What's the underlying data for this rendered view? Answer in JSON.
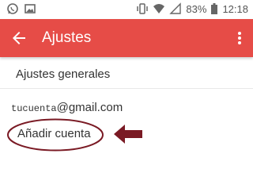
{
  "status_bar": {
    "battery_percent": "83%",
    "time": "12:18",
    "left_icons": [
      "whatsapp-icon",
      "image-icon"
    ],
    "right_icons": [
      "vibrate-icon",
      "wifi-icon",
      "signal-icon",
      "battery-icon"
    ]
  },
  "app_bar": {
    "title": "Ajustes",
    "background": "#e64c47",
    "back_icon": "arrow-back-icon",
    "menu_icon": "more-vert-icon"
  },
  "settings": {
    "general_label": "Ajustes generales",
    "account": {
      "user": "tucuenta",
      "domain": "@gmail.com"
    },
    "add_account_label": "Añadir cuenta"
  },
  "annotation": {
    "color": "#7a1a24",
    "shapes": [
      "ellipse-highlight",
      "left-arrow"
    ]
  }
}
